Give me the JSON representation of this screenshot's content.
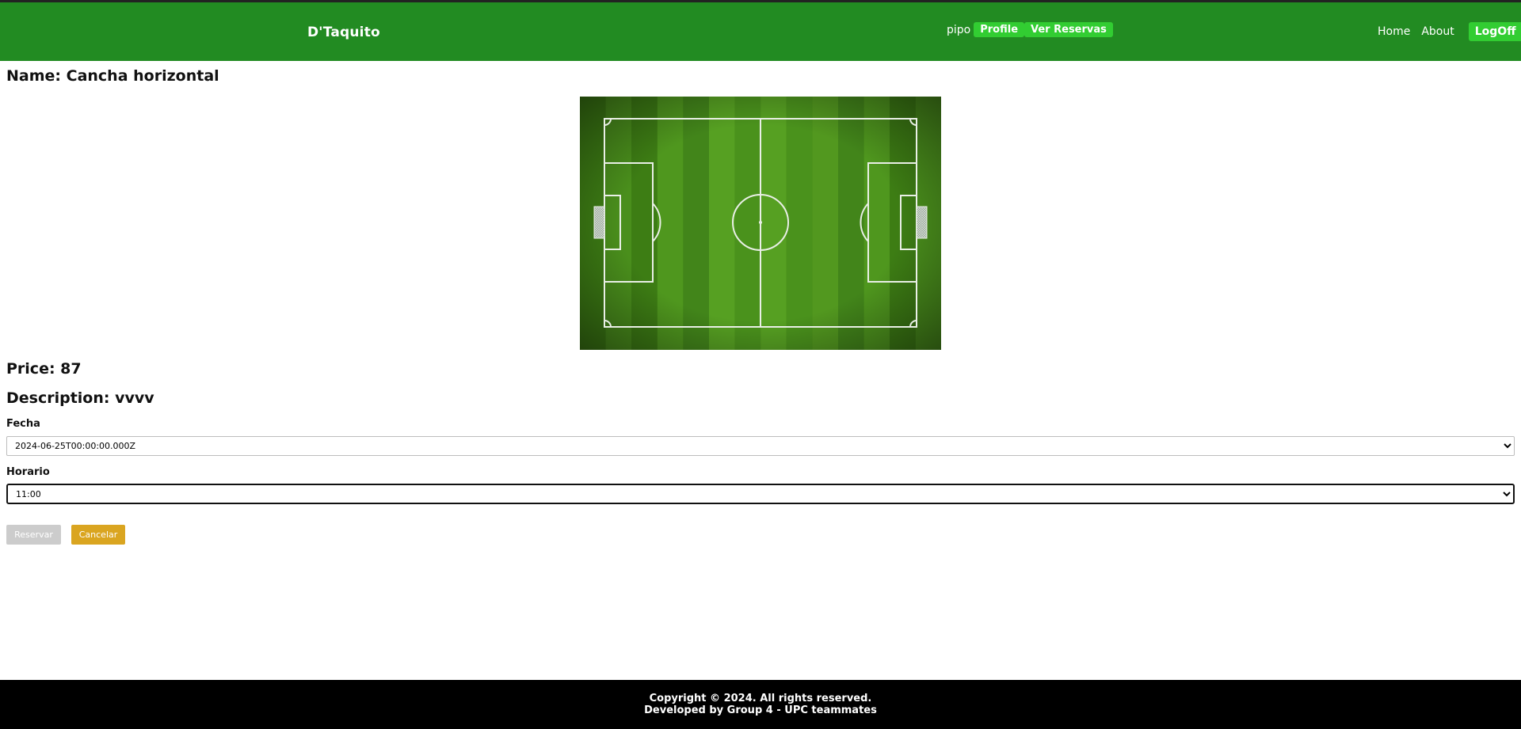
{
  "header": {
    "brand": "D'Taquito",
    "username": "pipo",
    "profile_label": "Profile",
    "reservas_label": "Ver Reservas",
    "nav": {
      "home": "Home",
      "about": "About",
      "logoff": "LogOff"
    }
  },
  "field": {
    "name_label": "Name: Cancha horizontal",
    "image_icon": "soccer-field-image",
    "price_label": "Price: 87",
    "description_label": "Description: vvvv"
  },
  "form": {
    "fecha_label": "Fecha",
    "fecha_value": "2024-06-25T00:00:00.000Z",
    "horario_label": "Horario",
    "horario_value": "11:00",
    "reservar_label": "Reservar",
    "cancelar_label": "Cancelar"
  },
  "footer": {
    "line1": "Copyright © 2024. All rights reserved.",
    "line2": "Developed by Group 4 - UPC teammates"
  },
  "colors": {
    "header_bg": "#228b22",
    "button_green": "#32cd32",
    "cancel_button": "#daa520",
    "disabled_button": "#cccccc",
    "footer_bg": "#000000"
  }
}
